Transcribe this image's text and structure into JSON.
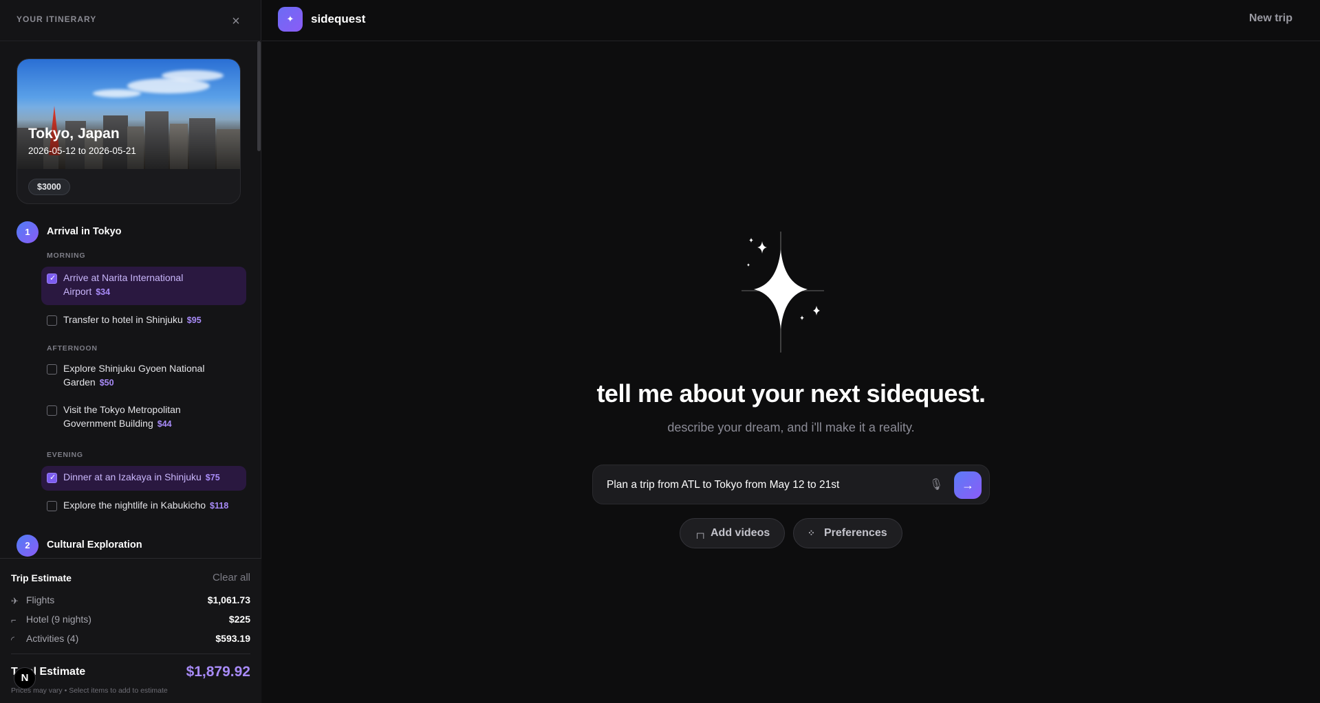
{
  "sidebar": {
    "title": "YOUR ITINERARY",
    "close_icon": "×",
    "trip": {
      "city": "Tokyo, Japan",
      "dates": "2026-05-12 to 2026-05-21",
      "budget": "$3000"
    },
    "days": [
      {
        "number": "1",
        "title": "Arrival in Tokyo",
        "slots": [
          {
            "label": "MORNING",
            "items": [
              {
                "text": "Arrive at Narita International Airport",
                "price": "$34",
                "checked": true
              },
              {
                "text": "Transfer to hotel in Shinjuku",
                "price": "$95",
                "checked": false
              }
            ]
          },
          {
            "label": "AFTERNOON",
            "items": [
              {
                "text": "Explore Shinjuku Gyoen National Garden",
                "price": "$50",
                "checked": false
              },
              {
                "text": "Visit the Tokyo Metropolitan Government Building",
                "price": "$44",
                "checked": false
              }
            ]
          },
          {
            "label": "EVENING",
            "items": [
              {
                "text": "Dinner at an Izakaya in Shinjuku",
                "price": "$75",
                "checked": true
              },
              {
                "text": "Explore the nightlife in Kabukicho",
                "price": "$118",
                "checked": false
              }
            ]
          }
        ]
      },
      {
        "number": "2",
        "title": "Cultural Exploration"
      }
    ]
  },
  "estimate": {
    "title": "Trip Estimate",
    "clear_label": "Clear all",
    "rows": [
      {
        "icon": "plane-icon",
        "label": "Flights",
        "value": "$1,061.73"
      },
      {
        "icon": "bed-icon",
        "label": "Hotel (9 nights)",
        "value": "$225"
      },
      {
        "icon": "activity-icon",
        "label": "Activities (4)",
        "value": "$593.19"
      }
    ],
    "total_label": "Total Estimate",
    "total_value": "$1,879.92",
    "note": "Prices may vary • Select items to add to estimate",
    "avatar_letter": "N"
  },
  "main": {
    "brand": "sidequest",
    "new_trip_label": "New trip",
    "headline": "tell me about your next sidequest.",
    "subhead": "describe your dream, and i'll make it a reality.",
    "prompt_value": "Plan a trip from ATL to Tokyo from May 12 to 21st",
    "add_videos_label": "Add videos",
    "preferences_label": "Preferences"
  },
  "colors": {
    "accent": "#8b5cf6",
    "price": "#a88bf8",
    "checked_bg": "#2a1840"
  }
}
